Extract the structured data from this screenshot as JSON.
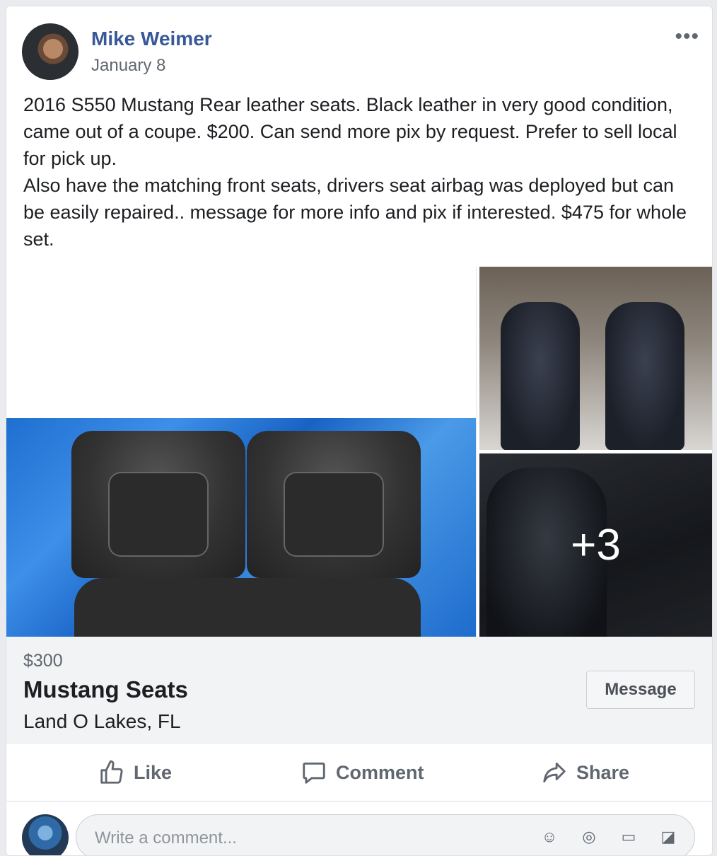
{
  "post": {
    "author": "Mike Weimer",
    "date": "January 8",
    "more_icon": "ellipsis-icon",
    "text_lines": [
      "2016 S550 Mustang Rear leather seats. Black leather in very good condition, came out of a coupe. $200. Can send more pix by request. Prefer to sell local for pick up.",
      "Also have the matching front seats, drivers seat airbag was deployed but can be easily repaired.. message for more info and pix if interested. $475 for whole set."
    ],
    "more_photos": "+3"
  },
  "listing": {
    "price": "$300",
    "title": "Mustang Seats",
    "location": "Land O Lakes, FL",
    "message_label": "Message"
  },
  "actions": {
    "like": "Like",
    "comment": "Comment",
    "share": "Share"
  },
  "comment_box": {
    "placeholder": "Write a comment...",
    "icons": [
      "emoji-icon",
      "camera-icon",
      "gif-icon",
      "sticker-icon"
    ]
  },
  "colors": {
    "author": "#385898",
    "muted": "#606770",
    "listing_bg": "#f2f3f5"
  }
}
